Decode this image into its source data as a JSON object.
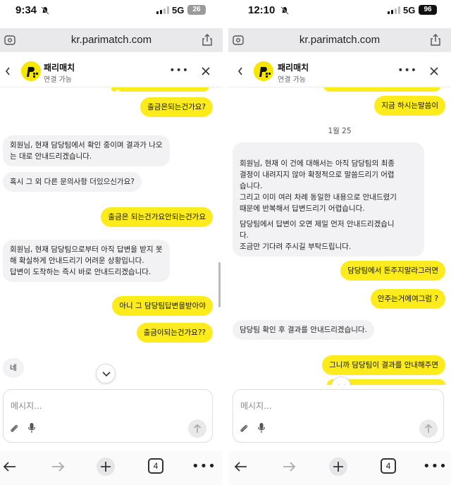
{
  "left": {
    "status": {
      "time": "9:34",
      "network": "5G",
      "battery": "26"
    },
    "browser": {
      "url": "kr.parimatch.com",
      "tab_count": "4"
    },
    "chat_header": {
      "name": "패리매치",
      "status": "연결 가능"
    },
    "messages": {
      "m1": "출금은되는건가요?",
      "m2": "회원님, 현재 담당팀에서 확인 중이며 결과가 나오\n는 대로 안내드리겠습니다.",
      "m3": "혹시 그 외 다른 문의사항 더있으신가요?",
      "m4": "출금은 되는건가요안되는건가요",
      "m5": "회원님, 현재 담당팀으로부터 아직 답변을 받지 못\n해 확실하게 안내드리기 어려운 상황입니다.\n답변이 도착하는 즉시 바로 안내드리겠습니다.",
      "m6": "아니 그 담당팀답변을받아야",
      "m7": "출금이되는건가요??",
      "m8": "네"
    },
    "composer": {
      "placeholder": "메시지..."
    }
  },
  "right": {
    "status": {
      "time": "12:10",
      "network": "5G",
      "battery": "96"
    },
    "browser": {
      "url": "kr.parimatch.com",
      "tab_count": "4"
    },
    "chat_header": {
      "name": "패리매치",
      "status": "연결 가능"
    },
    "messages": {
      "m1": "지금 하시는말씀이",
      "date": "1월 25",
      "m2a": "회원님, 현재 이 건에 대해서는 아직 담당팀의 최종\n결정이 내려지지 않아 확정적으로 말씀드리기 어렵\n습니다.\n그리고 이미 여러 차례 동일한 내용으로 안내드렸기\n때문에 반복해서 답변드리기 어렵습니다.",
      "m2b": "담당팀에서 답변이 오면 제일 먼저 안내드리겠습니\n다.\n조금만 기다려 주시길 부탁드립니다.",
      "m3": "담당팀에서 돈주지말라그러면",
      "m4": "안주는거에여그럼 ?",
      "m5": "담당팀 확인 후 결과를 안내드리겠습니다.",
      "m6": "그니까 담당팀이 결과를 안내해주면"
    },
    "composer": {
      "placeholder": "메시지..."
    }
  },
  "colors": {
    "my_bubble": "#fdeb1b",
    "their_bubble": "#f2f2f4",
    "brand_yellow": "#f7e600"
  },
  "icons": [
    "bell-mute-icon",
    "signal-icon",
    "battery-icon",
    "site-settings-icon",
    "share-icon",
    "chevron-left-icon",
    "avatar-logo",
    "more-icon",
    "close-icon",
    "chevron-down-icon",
    "paperclip-icon",
    "mic-icon",
    "send-arrow-icon",
    "back-arrow-icon",
    "forward-arrow-icon",
    "plus-icon",
    "tabs-icon",
    "menu-dots-icon"
  ]
}
